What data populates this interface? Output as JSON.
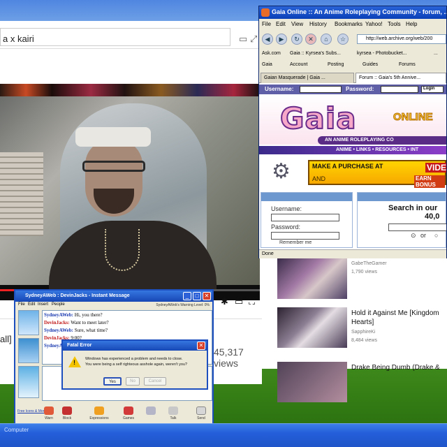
{
  "youtube": {
    "url_text": "a x kairi",
    "views": "45,317 views",
    "title_fragment": "all]",
    "progress": 0.27
  },
  "related": [
    {
      "title": "",
      "channel": "GabeTheGamer",
      "views": "1,790 views"
    },
    {
      "title": "Hold it Against Me [Kingdom Hearts]",
      "channel": "SapphireKi",
      "views": "8,484 views"
    },
    {
      "title": "Drake Being Dumb (Drake &",
      "channel": "",
      "views": ""
    }
  ],
  "gaia_window": {
    "title": "Gaia Online :: An Anime Roleplaying Community - forum, ...",
    "menu": [
      "File",
      "Edit",
      "View",
      "History",
      "Bookmarks",
      "Yahoo!",
      "Tools",
      "Help"
    ],
    "address": "http://web.archive.org/web/200",
    "bookmarks_row1": [
      "Ask.com",
      "Gaia :: Kyrsea's Subs...",
      "kyrsea - Photobucket...",
      "..."
    ],
    "bookmarks_row2": [
      "Gaia",
      "Account",
      "Posting",
      "Guides",
      "Forums"
    ],
    "tabs": [
      "Gaian Masquerade | Gaia ...",
      "Forum :: Gaia's 5th Annive..."
    ],
    "login": {
      "username_label": "Username:",
      "password_label": "Password:",
      "login_button": "Login"
    },
    "logo_text": "Gaia",
    "logo_suffix": "ONLINE",
    "tagline": "AN ANIME ROLEPLAYING CO",
    "nav": "ANIME • LINKS • RESOURCES • INT",
    "promo_line1": "MAKE A PURCHASE AT",
    "promo_brand": "VIDEO",
    "promo_line2": "AND",
    "promo_line3": "EARN BONUS",
    "panel_left": {
      "username": "Username:",
      "password": "Password:",
      "remember": "Remember me"
    },
    "panel_right": {
      "search_title": "Search in our",
      "search_count": "40,0",
      "radio": "or"
    },
    "status": "Done"
  },
  "im_window": {
    "title": "SydneyAWeb : DevinJacks - Instant Message",
    "menu": [
      "File",
      "Edit",
      "Insert",
      "People"
    ],
    "warning": "SydneyAWeb's Warning Level: 0%",
    "messages": [
      {
        "user": "SydneyAWeb:",
        "text": "Hi, you there?",
        "side": "1"
      },
      {
        "user": "DevinJacks:",
        "text": "Want to meet later?",
        "side": "2"
      },
      {
        "user": "SydneyAWeb:",
        "text": "Sure, what time?",
        "side": "1"
      },
      {
        "user": "DevinJacks:",
        "text": "9:00?",
        "side": "2"
      },
      {
        "user": "SydneyA",
        "text": "",
        "side": "1"
      }
    ],
    "free_icons": "Free Icons & More",
    "buttons": [
      "Warn",
      "Block",
      "Expressions",
      "Games",
      "",
      "Talk",
      "Send"
    ]
  },
  "error_dialog": {
    "title": "Fatal Error",
    "line1": "Windows has experienced a problem and needs to close.",
    "line2": "You were being a self righteous asshole again, weren't you?",
    "buttons": [
      "Yes",
      "No",
      "Cancel"
    ]
  },
  "taskbar": {
    "label": "Computer"
  },
  "colors": {
    "xp_blue": "#1d4fbf",
    "yt_red": "#e22222",
    "gaia_pink": "#f7a8c9",
    "im_red": "#c21818"
  }
}
